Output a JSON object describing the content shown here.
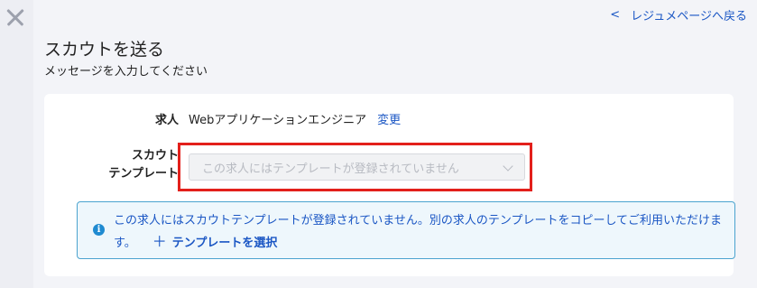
{
  "window": {
    "close_icon": "close-icon"
  },
  "header": {
    "back_link": "レジュメページへ戻る",
    "back_icon": "chevron-left-icon",
    "title": "スカウトを送る",
    "subtitle": "メッセージを入力してください"
  },
  "form": {
    "job_label": "求人",
    "job_value": "Webアプリケーションエンジニア",
    "change_link": "変更",
    "template_label_line1": "スカウト",
    "template_label_line2": "テンプレート",
    "template_select_placeholder": "この求人にはテンプレートが登録されていません"
  },
  "info": {
    "icon": "info-icon",
    "message": "この求人にはスカウトテンプレートが登録されていません。別の求人のテンプレートをコピーしてご利用いただけます。",
    "select_template_link": "テンプレートを選択",
    "plus_icon": "plus-icon"
  },
  "colors": {
    "accent": "#1a56c4",
    "highlight_border": "#e3201b",
    "info_background": "#eef7fc",
    "info_border": "#4ba3cf"
  }
}
